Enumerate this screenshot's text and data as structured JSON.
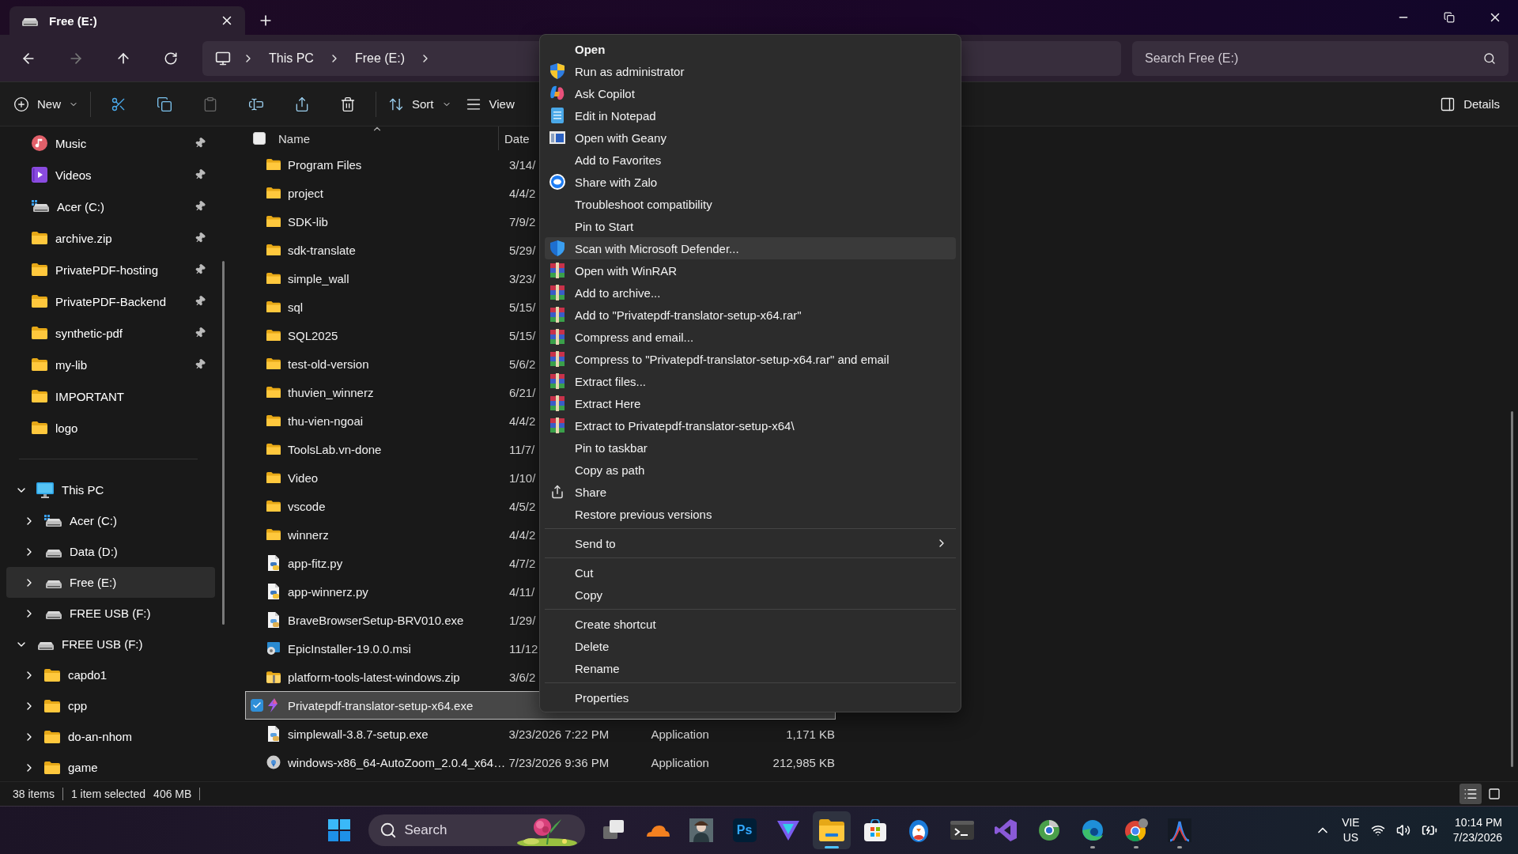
{
  "window": {
    "tab": {
      "title": "Free (E:)",
      "selected": true
    }
  },
  "address_bar": {
    "breadcrumb": [
      "This PC",
      "Free (E:)"
    ]
  },
  "search": {
    "placeholder": "Search Free (E:)"
  },
  "toolbar": {
    "buttons": [
      {
        "kind": "new",
        "label": "New",
        "disabled": false
      },
      {
        "kind": "cut",
        "disabled": false
      },
      {
        "kind": "copy",
        "disabled": false
      },
      {
        "kind": "paste",
        "disabled": true
      },
      {
        "kind": "rename",
        "disabled": false
      },
      {
        "kind": "share",
        "disabled": false
      },
      {
        "kind": "delete",
        "disabled": false
      },
      {
        "kind": "sort",
        "label": "Sort",
        "disabled": false
      },
      {
        "kind": "view",
        "label": "View",
        "disabled": false
      }
    ],
    "details": "Details"
  },
  "sidebar": {
    "quick_access": [
      {
        "label": "Music",
        "kind": "music",
        "pinned": true,
        "selected": false
      },
      {
        "label": "Videos",
        "kind": "video",
        "pinned": true,
        "selected": false
      },
      {
        "label": "Acer (C:)",
        "kind": "system-drive",
        "pinned": true,
        "selected": false
      },
      {
        "label": "archive.zip",
        "kind": "folder",
        "pinned": true,
        "selected": false
      },
      {
        "label": "PrivatePDF-hosting",
        "kind": "folder",
        "pinned": true,
        "selected": false
      },
      {
        "label": "PrivatePDF-Backend",
        "kind": "folder",
        "pinned": true,
        "selected": false
      },
      {
        "label": "synthetic-pdf",
        "kind": "folder",
        "pinned": true,
        "selected": false
      },
      {
        "label": "my-lib",
        "kind": "folder",
        "pinned": true,
        "selected": false
      },
      {
        "label": "IMPORTANT",
        "kind": "folder",
        "pinned": false,
        "selected": false
      },
      {
        "label": "logo",
        "kind": "folder",
        "pinned": false,
        "selected": false
      }
    ],
    "tree": [
      {
        "label": "This PC",
        "kind": "pc",
        "expanded": true,
        "selected": false,
        "children": [
          {
            "label": "Acer (C:)",
            "kind": "system-drive",
            "expanded": false,
            "selected": false
          },
          {
            "label": "Data (D:)",
            "kind": "drive",
            "expanded": false,
            "selected": false
          },
          {
            "label": "Free (E:)",
            "kind": "drive",
            "expanded": false,
            "selected": true
          },
          {
            "label": "FREE USB (F:)",
            "kind": "drive",
            "expanded": false,
            "selected": false
          }
        ]
      },
      {
        "label": "FREE USB (F:)",
        "kind": "drive",
        "expanded": true,
        "selected": false,
        "children": [
          {
            "label": "capdo1",
            "kind": "folder",
            "expanded": false,
            "selected": false
          },
          {
            "label": "cpp",
            "kind": "folder",
            "expanded": false,
            "selected": false
          },
          {
            "label": "do-an-nhom",
            "kind": "folder",
            "expanded": false,
            "selected": false
          },
          {
            "label": "game",
            "kind": "folder",
            "expanded": false,
            "selected": false
          }
        ]
      }
    ]
  },
  "file_list": {
    "columns": [
      "Name",
      "Date"
    ],
    "select_all_checked": false,
    "rows": [
      {
        "name": "Program Files",
        "kind": "folder",
        "date": "3/14/",
        "selected": false
      },
      {
        "name": "project",
        "kind": "folder",
        "date": "4/4/2",
        "selected": false
      },
      {
        "name": "SDK-lib",
        "kind": "folder",
        "date": "7/9/2",
        "selected": false
      },
      {
        "name": "sdk-translate",
        "kind": "folder",
        "date": "5/29/",
        "selected": false
      },
      {
        "name": "simple_wall",
        "kind": "folder",
        "date": "3/23/",
        "selected": false
      },
      {
        "name": "sql",
        "kind": "folder",
        "date": "5/15/",
        "selected": false
      },
      {
        "name": "SQL2025",
        "kind": "folder",
        "date": "5/15/",
        "selected": false
      },
      {
        "name": "test-old-version",
        "kind": "folder",
        "date": "5/6/2",
        "selected": false
      },
      {
        "name": "thuvien_winnerz",
        "kind": "folder",
        "date": "6/21/",
        "selected": false
      },
      {
        "name": "thu-vien-ngoai",
        "kind": "folder",
        "date": "4/4/2",
        "selected": false
      },
      {
        "name": "ToolsLab.vn-done",
        "kind": "folder",
        "date": "11/7/",
        "selected": false
      },
      {
        "name": "Video",
        "kind": "folder",
        "date": "1/10/",
        "selected": false
      },
      {
        "name": "vscode",
        "kind": "folder",
        "date": "4/5/2",
        "selected": false
      },
      {
        "name": "winnerz",
        "kind": "folder",
        "date": "4/4/2",
        "selected": false
      },
      {
        "name": "app-fitz.py",
        "kind": "python",
        "date": "4/7/2",
        "selected": false
      },
      {
        "name": "app-winnerz.py",
        "kind": "python",
        "date": "4/11/",
        "selected": false
      },
      {
        "name": "BraveBrowserSetup-BRV010.exe",
        "kind": "installer",
        "date": "1/29/",
        "selected": false
      },
      {
        "name": "EpicInstaller-19.0.0.msi",
        "kind": "msi",
        "date": "11/12",
        "selected": false
      },
      {
        "name": "platform-tools-latest-windows.zip",
        "kind": "zip",
        "date": "3/6/2",
        "selected": false
      },
      {
        "name": "Privatepdf-translator-setup-x64.exe",
        "kind": "app",
        "selected": true
      },
      {
        "name": "simplewall-3.8.7-setup.exe",
        "kind": "installer",
        "date": "3/23/2026 7:22 PM",
        "type": "Application",
        "size": "1,171 KB",
        "selected": false
      },
      {
        "name": "windows-x86_64-AutoZoom_2.0.4_x64…",
        "kind": "disc",
        "date": "7/23/2026 9:36 PM",
        "type": "Application",
        "size": "212,985 KB",
        "selected": false
      }
    ]
  },
  "context_menu": {
    "groups": [
      [
        {
          "label": "Open",
          "kind": "default",
          "selected": false
        },
        {
          "label": "Run as administrator",
          "kind": "uac",
          "selected": false
        },
        {
          "label": "Ask Copilot",
          "kind": "copilot",
          "selected": false
        },
        {
          "label": "Edit in Notepad",
          "kind": "notepad",
          "selected": false
        },
        {
          "label": "Open with Geany",
          "kind": "geany",
          "selected": false
        },
        {
          "label": "Add to Favorites",
          "kind": "plain",
          "selected": false
        },
        {
          "label": "Share with Zalo",
          "kind": "zalo",
          "selected": false
        },
        {
          "label": "Troubleshoot compatibility",
          "kind": "plain",
          "selected": false
        },
        {
          "label": "Pin to Start",
          "kind": "plain",
          "selected": false
        },
        {
          "label": "Scan with Microsoft Defender...",
          "kind": "defender",
          "selected": true
        },
        {
          "label": "Open with WinRAR",
          "kind": "winrar",
          "selected": false
        },
        {
          "label": "Add to archive...",
          "kind": "winrar",
          "selected": false
        },
        {
          "label": "Add to \"Privatepdf-translator-setup-x64.rar\"",
          "kind": "winrar",
          "selected": false
        },
        {
          "label": "Compress and email...",
          "kind": "winrar",
          "selected": false
        },
        {
          "label": "Compress to \"Privatepdf-translator-setup-x64.rar\" and email",
          "kind": "winrar",
          "selected": false
        },
        {
          "label": "Extract files...",
          "kind": "winrar",
          "selected": false
        },
        {
          "label": "Extract Here",
          "kind": "winrar",
          "selected": false
        },
        {
          "label": "Extract to Privatepdf-translator-setup-x64\\",
          "kind": "winrar",
          "selected": false
        },
        {
          "label": "Pin to taskbar",
          "kind": "plain",
          "selected": false
        },
        {
          "label": "Copy as path",
          "kind": "plain",
          "selected": false
        },
        {
          "label": "Share",
          "kind": "share",
          "selected": false
        },
        {
          "label": "Restore previous versions",
          "kind": "plain",
          "selected": false
        }
      ],
      [
        {
          "label": "Send to",
          "kind": "submenu",
          "selected": false
        }
      ],
      [
        {
          "label": "Cut",
          "kind": "plain",
          "selected": false
        },
        {
          "label": "Copy",
          "kind": "plain",
          "selected": false
        }
      ],
      [
        {
          "label": "Create shortcut",
          "kind": "plain",
          "selected": false
        },
        {
          "label": "Delete",
          "kind": "plain",
          "selected": false
        },
        {
          "label": "Rename",
          "kind": "plain",
          "selected": false
        }
      ],
      [
        {
          "label": "Properties",
          "kind": "plain",
          "selected": false
        }
      ]
    ]
  },
  "status_bar": {
    "items": [
      "38 items",
      "1 item selected",
      "406 MB"
    ],
    "views": [
      {
        "kind": "details",
        "selected": true
      },
      {
        "kind": "tiles",
        "selected": false
      }
    ]
  },
  "taskbar": {
    "search": {
      "placeholder": "Search"
    },
    "apps": [
      {
        "kind": "taskview",
        "active": false,
        "running": false
      },
      {
        "kind": "cloud",
        "active": false,
        "running": false
      },
      {
        "kind": "figure",
        "active": false,
        "running": false
      },
      {
        "kind": "photo-editor",
        "label": "Ps",
        "active": false,
        "running": false
      },
      {
        "kind": "triangle",
        "active": false,
        "running": false
      },
      {
        "kind": "explorer",
        "active": true,
        "running": true
      },
      {
        "kind": "store",
        "active": false,
        "running": false
      },
      {
        "kind": "penguin",
        "active": false,
        "running": false
      },
      {
        "kind": "terminal",
        "active": false,
        "running": false
      },
      {
        "kind": "studio",
        "active": false,
        "running": false
      },
      {
        "kind": "globe",
        "active": false,
        "running": false
      },
      {
        "kind": "edge",
        "active": false,
        "running": true
      },
      {
        "kind": "chrome",
        "active": false,
        "running": true
      },
      {
        "kind": "peak",
        "active": false,
        "running": true
      }
    ],
    "tray": {
      "language": "VIE",
      "region": "US",
      "time": "10:14 PM",
      "date": "7/23/2026"
    }
  }
}
